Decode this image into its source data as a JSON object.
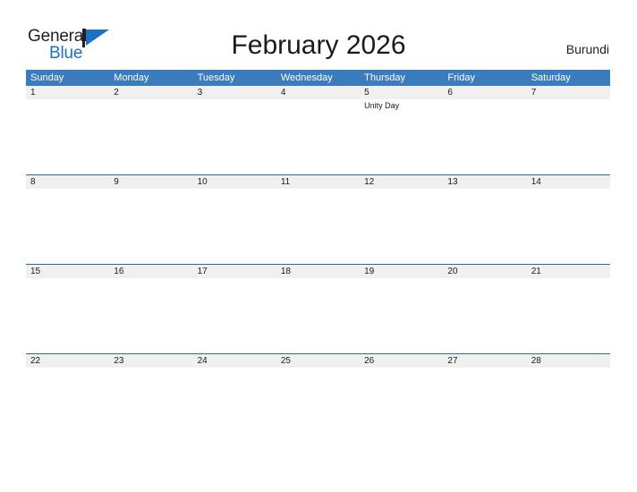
{
  "brand": {
    "word_one": "General",
    "word_two": "Blue",
    "mark_icon": "flag-triangle-icon",
    "color_dark": "#231f20",
    "color_blue": "#1b72c0"
  },
  "header": {
    "title": "February 2026",
    "country": "Burundi"
  },
  "theme": {
    "header_band": "#3a7cbd",
    "week_separator": "#2e6da4",
    "day_strip": "#f0f0f0",
    "page_background": "#ffffff",
    "text": "#1a1a1a"
  },
  "calendar": {
    "weekdays": [
      "Sunday",
      "Monday",
      "Tuesday",
      "Wednesday",
      "Thursday",
      "Friday",
      "Saturday"
    ],
    "weeks": [
      {
        "days": [
          {
            "num": "1",
            "events": []
          },
          {
            "num": "2",
            "events": []
          },
          {
            "num": "3",
            "events": []
          },
          {
            "num": "4",
            "events": []
          },
          {
            "num": "5",
            "events": [
              "Unity Day"
            ]
          },
          {
            "num": "6",
            "events": []
          },
          {
            "num": "7",
            "events": []
          }
        ]
      },
      {
        "days": [
          {
            "num": "8",
            "events": []
          },
          {
            "num": "9",
            "events": []
          },
          {
            "num": "10",
            "events": []
          },
          {
            "num": "11",
            "events": []
          },
          {
            "num": "12",
            "events": []
          },
          {
            "num": "13",
            "events": []
          },
          {
            "num": "14",
            "events": []
          }
        ]
      },
      {
        "days": [
          {
            "num": "15",
            "events": []
          },
          {
            "num": "16",
            "events": []
          },
          {
            "num": "17",
            "events": []
          },
          {
            "num": "18",
            "events": []
          },
          {
            "num": "19",
            "events": []
          },
          {
            "num": "20",
            "events": []
          },
          {
            "num": "21",
            "events": []
          }
        ]
      },
      {
        "days": [
          {
            "num": "22",
            "events": []
          },
          {
            "num": "23",
            "events": []
          },
          {
            "num": "24",
            "events": []
          },
          {
            "num": "25",
            "events": []
          },
          {
            "num": "26",
            "events": []
          },
          {
            "num": "27",
            "events": []
          },
          {
            "num": "28",
            "events": []
          }
        ]
      }
    ]
  }
}
